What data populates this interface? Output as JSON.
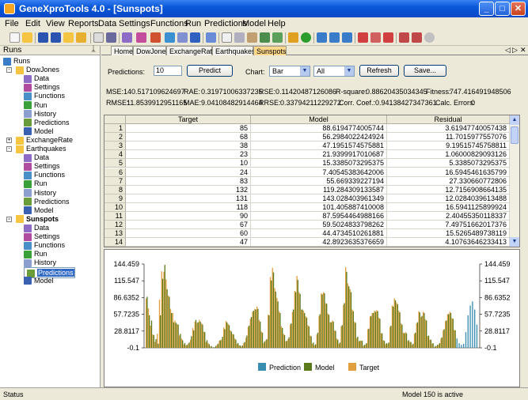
{
  "window": {
    "title": "GeneXproTools 4.0 - [Sunspots]",
    "min": "_",
    "max": "□",
    "close": "✕"
  },
  "menu": [
    "File",
    "Edit",
    "View",
    "Reports",
    "Data",
    "Settings",
    "Functions",
    "Run",
    "Predictions",
    "Model",
    "Help"
  ],
  "runs_panel": {
    "title": "Runs",
    "pin": "ᛣ",
    "tree": [
      {
        "label": "Runs",
        "level": 0
      },
      {
        "label": "DowJones",
        "level": 1,
        "exp": "-"
      },
      {
        "label": "Data",
        "level": 2
      },
      {
        "label": "Settings",
        "level": 2
      },
      {
        "label": "Functions",
        "level": 2
      },
      {
        "label": "Run",
        "level": 2
      },
      {
        "label": "History",
        "level": 2
      },
      {
        "label": "Predictions",
        "level": 2
      },
      {
        "label": "Model",
        "level": 2
      },
      {
        "label": "ExchangeRate",
        "level": 1,
        "exp": "+"
      },
      {
        "label": "Earthquakes",
        "level": 1,
        "exp": "-"
      },
      {
        "label": "Data",
        "level": 2
      },
      {
        "label": "Settings",
        "level": 2
      },
      {
        "label": "Functions",
        "level": 2
      },
      {
        "label": "Run",
        "level": 2
      },
      {
        "label": "History",
        "level": 2
      },
      {
        "label": "Predictions",
        "level": 2
      },
      {
        "label": "Model",
        "level": 2
      },
      {
        "label": "Sunspots",
        "level": 1,
        "exp": "-",
        "bold": true
      },
      {
        "label": "Data",
        "level": 2
      },
      {
        "label": "Settings",
        "level": 2
      },
      {
        "label": "Functions",
        "level": 2
      },
      {
        "label": "Run",
        "level": 2
      },
      {
        "label": "History",
        "level": 2
      },
      {
        "label": "Predictions",
        "level": 2,
        "selected": true
      },
      {
        "label": "Model",
        "level": 2
      }
    ]
  },
  "tabs": [
    "Home",
    "DowJones",
    "ExchangeRate",
    "Earthquakes",
    "Sunspots"
  ],
  "tab_controls": {
    "left": "◁",
    "right": "▷",
    "close": "✕"
  },
  "controls": {
    "predictions_label": "Predictions:",
    "predictions_value": "10",
    "predict_button": "Predict",
    "chart_label": "Chart:",
    "chart_type": "Bar",
    "range": "All",
    "refresh_button": "Refresh",
    "save_button": "Save..."
  },
  "stats": {
    "mse_label": "MSE:",
    "mse": "140.517109624697",
    "rae_label": "RAE:",
    "rae": "0.31971006337235",
    "rse_label": "RSE:",
    "rse": "0.11420487126086",
    "rsq_label": "R-square:",
    "rsq": "0.88620435034345",
    "fitness_label": "Fitness:",
    "fitness": "747.416491948506",
    "rmse_label": "RMSE:",
    "rmse": "11.8539912951165",
    "mae_label": "MAE:",
    "mae": "9.04108482914464",
    "rrse_label": "RRSE:",
    "rrse": "0.33794211229272",
    "corr_label": "Corr. Coef.:",
    "corr": "0.94138427347361",
    "calc_label": "Calc. Errors:",
    "calc": "0"
  },
  "grid": {
    "headers": [
      "Target",
      "Model",
      "Residual"
    ],
    "rows": [
      {
        "n": "1",
        "target": "85",
        "model": "88.6194774005744",
        "residual": "3.61947740057438"
      },
      {
        "n": "2",
        "target": "68",
        "model": "56.2984022424924",
        "residual": "11.7015977557076"
      },
      {
        "n": "3",
        "target": "38",
        "model": "47.1951574575881",
        "residual": "9.19515745758811"
      },
      {
        "n": "4",
        "target": "23",
        "model": "21.9399917010687",
        "residual": "1.06000829093126"
      },
      {
        "n": "5",
        "target": "10",
        "model": "15.3385073295375",
        "residual": "5.3385073295375"
      },
      {
        "n": "6",
        "target": "24",
        "model": "7.40545383642006",
        "residual": "16.5945461635799"
      },
      {
        "n": "7",
        "target": "83",
        "model": "55.669339227194",
        "residual": "27.330660772806"
      },
      {
        "n": "8",
        "target": "132",
        "model": "119.284309133587",
        "residual": "12.7156908664135"
      },
      {
        "n": "9",
        "target": "131",
        "model": "143.028403961349",
        "residual": "12.0284039613488"
      },
      {
        "n": "10",
        "target": "118",
        "model": "101.405887410008",
        "residual": "16.5941125899924"
      },
      {
        "n": "11",
        "target": "90",
        "model": "87.5954464988166",
        "residual": "2.40455350118337"
      },
      {
        "n": "12",
        "target": "67",
        "model": "59.5024833798262",
        "residual": "7.49751662017376"
      },
      {
        "n": "13",
        "target": "60",
        "model": "44.4734510261881",
        "residual": "15.5265489738119"
      },
      {
        "n": "14",
        "target": "47",
        "model": "42.8923635376659",
        "residual": "4.10763646233413"
      }
    ],
    "scroll_up": "▲",
    "scroll_down": "▼"
  },
  "chart_data": {
    "type": "bar",
    "ylim": [
      -0.1,
      144.459
    ],
    "yticks": [
      "144.459",
      "115.547",
      "86.6352",
      "57.7235",
      "28.8117",
      "-0.1"
    ],
    "legend": [
      "Prediction",
      "Model",
      "Target"
    ],
    "colors": {
      "Prediction": "#3a8fb0",
      "Model": "#5c7a1c",
      "Target": "#e0a040"
    },
    "targets": [
      85,
      68,
      38,
      23,
      10,
      24,
      83,
      132,
      131,
      118,
      90,
      67,
      60,
      47,
      41,
      21,
      16,
      6,
      4,
      7,
      14,
      34,
      45,
      43,
      48,
      42,
      28,
      10,
      8,
      2,
      0,
      1,
      5,
      12,
      14,
      35,
      46,
      41,
      30,
      24,
      16,
      7,
      4,
      2,
      8,
      17,
      36,
      50,
      62,
      67,
      71,
      48,
      28,
      8,
      13,
      57,
      122,
      138,
      103,
      86,
      63,
      37,
      24,
      11,
      15,
      40,
      62,
      98,
      124,
      96,
      66,
      64,
      54,
      39,
      21,
      7,
      4,
      23,
      55,
      94,
      96,
      77,
      59,
      44,
      47,
      30,
      16,
      7,
      37,
      74,
      139,
      111,
      101,
      66,
      45,
      17,
      11,
      12,
      3,
      6,
      32,
      54,
      60,
      64,
      65,
      52,
      25,
      13,
      6,
      7,
      36,
      73,
      85,
      78,
      64,
      42,
      26,
      27,
      12,
      10,
      5,
      24,
      42,
      63,
      53,
      62,
      49,
      20,
      14,
      7,
      1,
      3,
      6,
      16,
      30,
      46,
      58,
      62,
      51,
      31,
      16,
      7,
      3,
      5,
      25,
      55,
      75,
      85,
      68,
      38
    ],
    "models": [
      88,
      56,
      47,
      22,
      15,
      7,
      56,
      119,
      143,
      101,
      88,
      60,
      44,
      43,
      40,
      24,
      13,
      8,
      5,
      9,
      20,
      30,
      48,
      44,
      45,
      40,
      27,
      13,
      6,
      3,
      1,
      3,
      7,
      13,
      19,
      32,
      44,
      39,
      28,
      23,
      14,
      8,
      4,
      4,
      10,
      21,
      38,
      53,
      64,
      66,
      67,
      45,
      26,
      11,
      15,
      56,
      116,
      130,
      97,
      80,
      60,
      34,
      22,
      12,
      18,
      42,
      66,
      96,
      117,
      93,
      66,
      60,
      52,
      37,
      20,
      9,
      6,
      26,
      58,
      92,
      94,
      76,
      57,
      44,
      45,
      29,
      14,
      9,
      39,
      77,
      131,
      106,
      96,
      63,
      43,
      19,
      12,
      12,
      5,
      8,
      33,
      55,
      60,
      62,
      63,
      50,
      25,
      12,
      8,
      9,
      38,
      71,
      82,
      75,
      61,
      40,
      25,
      25,
      13,
      10,
      7,
      26,
      44,
      61,
      55,
      60,
      47,
      21,
      14,
      8,
      3,
      5,
      8,
      18,
      32,
      47,
      58,
      60,
      50,
      30,
      16,
      8,
      5,
      7,
      27,
      56,
      73,
      80,
      66,
      40
    ],
    "prediction_start": 140
  },
  "status": {
    "left": "Status",
    "right": "Model 150 is active"
  }
}
